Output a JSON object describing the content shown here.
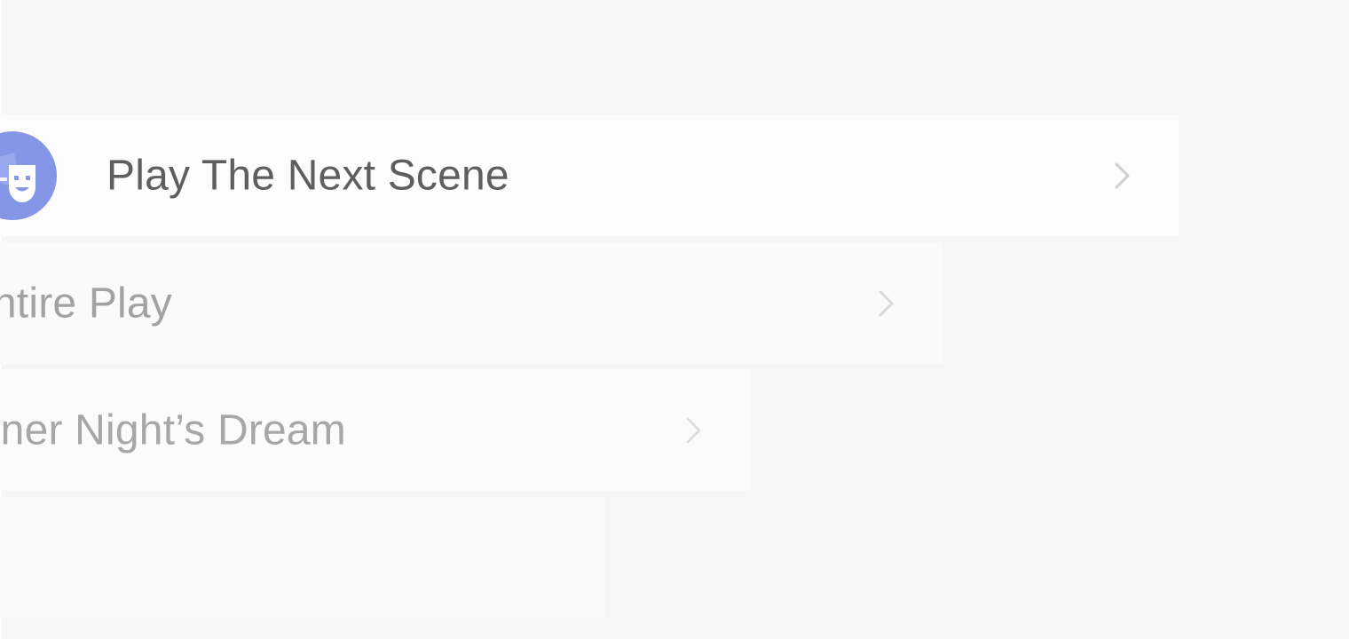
{
  "colors": {
    "background": "#f6f6f6",
    "avatar": "#8596e6",
    "active_text": "#5e5e5e",
    "inactive_text": "#a2a2a2",
    "chevron": "#c8c8c8"
  },
  "menu": {
    "items": [
      {
        "label": "Play The Next Scene",
        "icon": "theater-mask-icon",
        "trailing_icon": "chevron-right-icon"
      },
      {
        "label": "ntire Play",
        "trailing_icon": "chevron-right-icon"
      },
      {
        "label": "ner Night’s Dream",
        "trailing_icon": "chevron-right-icon"
      },
      {
        "label": ""
      }
    ]
  }
}
